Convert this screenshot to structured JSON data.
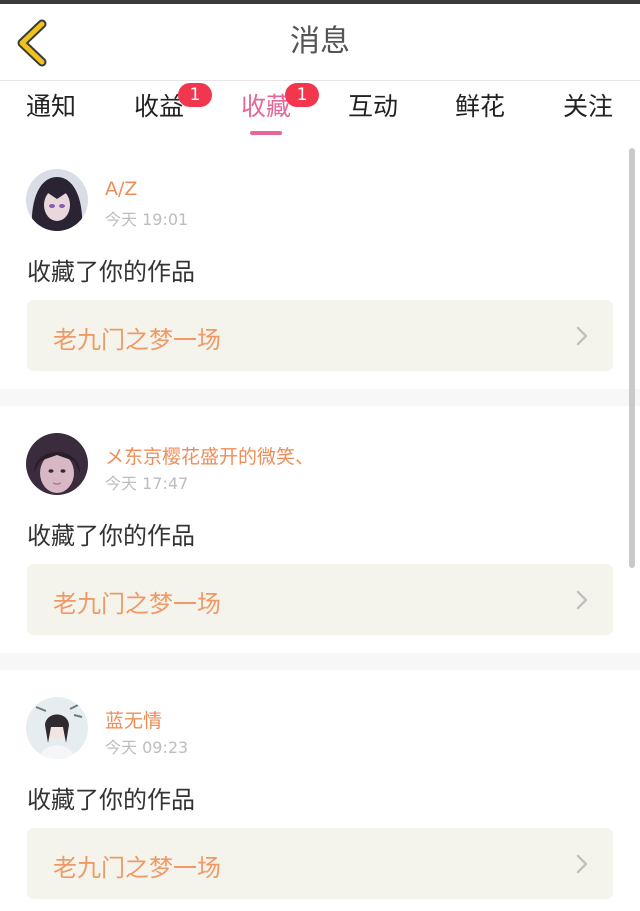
{
  "header": {
    "title": "消息",
    "back_icon": "chevron-left-icon",
    "back_icon_color": "#f0c21c"
  },
  "tabs": [
    {
      "label": "通知"
    },
    {
      "label": "收益",
      "badge": "1"
    },
    {
      "label": "收藏",
      "badge": "1",
      "active": true
    },
    {
      "label": "互动"
    },
    {
      "label": "鲜花"
    },
    {
      "label": "关注"
    }
  ],
  "colors": {
    "accent": "#e5679a",
    "badge": "#f2364d",
    "username": "#ef8d58",
    "work_title": "#ef9a66"
  },
  "messages": [
    {
      "username": "A/Z",
      "time": "今天 19:01",
      "action": "收藏了你的作品",
      "work_title": "老九门之梦一场"
    },
    {
      "username": "メ东京樱花盛开的微笑、",
      "time": "今天 17:47",
      "action": "收藏了你的作品",
      "work_title": "老九门之梦一场"
    },
    {
      "username": "蓝无情",
      "time": "今天 09:23",
      "action": "收藏了你的作品",
      "work_title": "老九门之梦一场"
    }
  ]
}
